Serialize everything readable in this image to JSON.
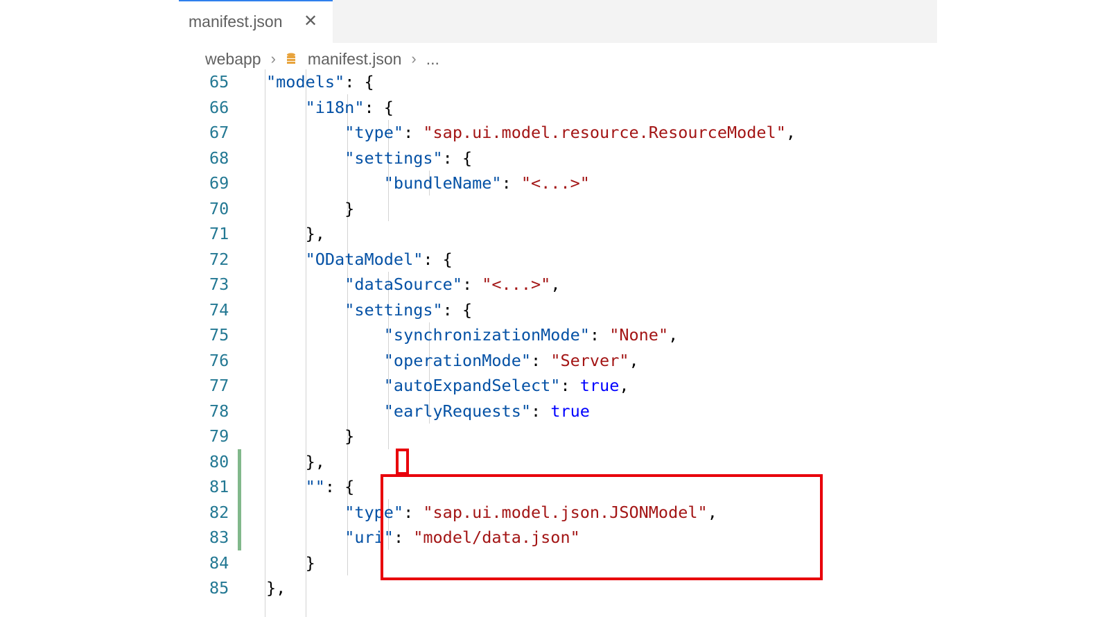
{
  "tab": {
    "title": "manifest.json",
    "close_glyph": "✕"
  },
  "breadcrumb": {
    "folder": "webapp",
    "file": "manifest.json",
    "more": "...",
    "separator": "›"
  },
  "colors": {
    "key": "#0451a5",
    "string": "#a31515",
    "boolean": "#0000ff",
    "line_number": "#237893",
    "highlight": "#e8000b",
    "gutter_modified": "#81b88b"
  },
  "icons": {
    "file_type": "json-file-icon"
  },
  "code_lines": [
    {
      "n": "65",
      "t": "            \"models\": {"
    },
    {
      "n": "66",
      "t": "                \"i18n\": {"
    },
    {
      "n": "67",
      "t": "                    \"type\": \"sap.ui.model.resource.ResourceModel\","
    },
    {
      "n": "68",
      "t": "                    \"settings\": {"
    },
    {
      "n": "69",
      "t": "                        \"bundleName\": \"<...>\""
    },
    {
      "n": "70",
      "t": "                    }"
    },
    {
      "n": "71",
      "t": "                },"
    },
    {
      "n": "72",
      "t": "                \"ODataModel\": {"
    },
    {
      "n": "73",
      "t": "                    \"dataSource\": \"<...>\","
    },
    {
      "n": "74",
      "t": "                    \"settings\": {"
    },
    {
      "n": "75",
      "t": "                        \"synchronizationMode\": \"None\","
    },
    {
      "n": "76",
      "t": "                        \"operationMode\": \"Server\","
    },
    {
      "n": "77",
      "t": "                        \"autoExpandSelect\": true,"
    },
    {
      "n": "78",
      "t": "                        \"earlyRequests\": true"
    },
    {
      "n": "79",
      "t": "                    }"
    },
    {
      "n": "80",
      "t": "                },"
    },
    {
      "n": "81",
      "t": "                \"\": {"
    },
    {
      "n": "82",
      "t": "                    \"type\": \"sap.ui.model.json.JSONModel\","
    },
    {
      "n": "83",
      "t": "                    \"uri\": \"model/data.json\""
    },
    {
      "n": "84",
      "t": "                }"
    },
    {
      "n": "85",
      "t": "            },"
    }
  ],
  "modified_lines": [
    "80",
    "81",
    "82",
    "83"
  ]
}
